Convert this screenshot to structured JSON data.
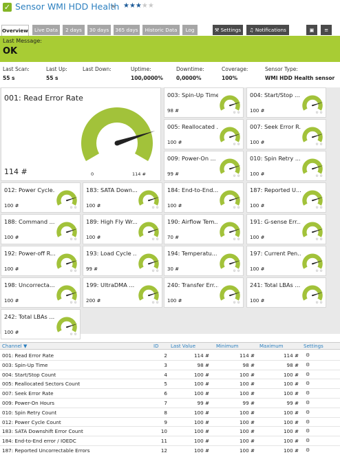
{
  "header": {
    "title": "Sensor WMI HDD Health",
    "stars_on": "★★★",
    "stars_off": "★★",
    "flag": "⚑"
  },
  "tabs": [
    {
      "label": "Overview",
      "active": true
    },
    {
      "label": "Live Data"
    },
    {
      "label": "2 days"
    },
    {
      "label": "30 days"
    },
    {
      "label": "365 days"
    },
    {
      "label": "Historic Data"
    },
    {
      "label": "Log"
    }
  ],
  "toolbar": {
    "settings": "Settings",
    "notifications": "Notifications"
  },
  "message": {
    "label": "Last Message:",
    "value": "OK"
  },
  "stats": [
    {
      "k": "Last Scan:",
      "v": "55 s"
    },
    {
      "k": "Last Up:",
      "v": "55 s"
    },
    {
      "k": "Last Down:",
      "v": ""
    },
    {
      "k": "Uptime:",
      "v": "100,0000%"
    },
    {
      "k": "Downtime:",
      "v": "0,0000%"
    },
    {
      "k": "Coverage:",
      "v": "100%"
    },
    {
      "k": "Sensor Type:",
      "v": "WMI HDD Health sensor"
    }
  ],
  "big_gauge": {
    "name": "001: Read Error Rate",
    "value": "114 #",
    "min": "0",
    "max": "114 #",
    "level": 0.8
  },
  "gauges": [
    {
      "name": "003: Spin-Up Time",
      "value": "98 #",
      "level": 0.8
    },
    {
      "name": "004: Start/Stop ...",
      "value": "100 #",
      "level": 0.8
    },
    {
      "name": "005: Reallocated ...",
      "value": "100 #",
      "level": 0.8
    },
    {
      "name": "007: Seek Error R...",
      "value": "100 #",
      "level": 0.8
    },
    {
      "name": "009: Power-On ...",
      "value": "99 #",
      "level": 0.8
    },
    {
      "name": "010: Spin Retry ...",
      "value": "100 #",
      "level": 0.8
    },
    {
      "name": "012: Power Cycle...",
      "value": "100 #",
      "level": 0.8
    },
    {
      "name": "183: SATA Down...",
      "value": "100 #",
      "level": 0.8
    },
    {
      "name": "184: End-to-End...",
      "value": "100 #",
      "level": 0.8
    },
    {
      "name": "187: Reported U...",
      "value": "100 #",
      "level": 0.8
    },
    {
      "name": "188: Command ...",
      "value": "100 #",
      "level": 0.8
    },
    {
      "name": "189: High Fly Wr...",
      "value": "100 #",
      "level": 0.8
    },
    {
      "name": "190: Airflow Tem...",
      "value": "70 #",
      "level": 0.8
    },
    {
      "name": "191: G-sense Err...",
      "value": "100 #",
      "level": 0.8
    },
    {
      "name": "192: Power-off R...",
      "value": "100 #",
      "level": 0.8
    },
    {
      "name": "193: Load Cycle ...",
      "value": "99 #",
      "level": 0.8
    },
    {
      "name": "194: Temperatu...",
      "value": "30 #",
      "level": 0.8
    },
    {
      "name": "197: Current Pen...",
      "value": "100 #",
      "level": 0.8
    },
    {
      "name": "198: Uncorrecta...",
      "value": "100 #",
      "level": 0.8
    },
    {
      "name": "199: UltraDMA ...",
      "value": "200 #",
      "level": 0.8
    },
    {
      "name": "240: Transfer Err...",
      "value": "100 #",
      "level": 0.8
    },
    {
      "name": "241: Total LBAs ...",
      "value": "100 #",
      "level": 0.8
    },
    {
      "name": "242: Total LBAs ...",
      "value": "100 #",
      "level": 0.8
    }
  ],
  "table": {
    "headers": {
      "channel": "Channel ▼",
      "id": "ID",
      "last_value": "Last Value",
      "minimum": "Minimum",
      "maximum": "Maximum",
      "settings": "Settings"
    },
    "rows": [
      {
        "channel": "001: Read Error Rate",
        "id": "2",
        "lv": "114 #",
        "min": "114 #",
        "max": "114 #"
      },
      {
        "channel": "003: Spin-Up Time",
        "id": "3",
        "lv": "98 #",
        "min": "98 #",
        "max": "98 #"
      },
      {
        "channel": "004: Start/Stop Count",
        "id": "4",
        "lv": "100 #",
        "min": "100 #",
        "max": "100 #"
      },
      {
        "channel": "005: Reallocated Sectors Count",
        "id": "5",
        "lv": "100 #",
        "min": "100 #",
        "max": "100 #"
      },
      {
        "channel": "007: Seek Error Rate",
        "id": "6",
        "lv": "100 #",
        "min": "100 #",
        "max": "100 #"
      },
      {
        "channel": "009: Power-On Hours",
        "id": "7",
        "lv": "99 #",
        "min": "99 #",
        "max": "99 #"
      },
      {
        "channel": "010: Spin Retry Count",
        "id": "8",
        "lv": "100 #",
        "min": "100 #",
        "max": "100 #"
      },
      {
        "channel": "012: Power Cycle Count",
        "id": "9",
        "lv": "100 #",
        "min": "100 #",
        "max": "100 #"
      },
      {
        "channel": "183: SATA Downshift Error Count",
        "id": "10",
        "lv": "100 #",
        "min": "100 #",
        "max": "100 #"
      },
      {
        "channel": "184: End-to-End error / IOEDC",
        "id": "11",
        "lv": "100 #",
        "min": "100 #",
        "max": "100 #"
      },
      {
        "channel": "187: Reported Uncorrectable Errors",
        "id": "12",
        "lv": "100 #",
        "min": "100 #",
        "max": "100 #"
      }
    ]
  },
  "colors": {
    "accent": "#a8cc34",
    "gauge": "#a2c23a",
    "link": "#2b7fbf"
  }
}
